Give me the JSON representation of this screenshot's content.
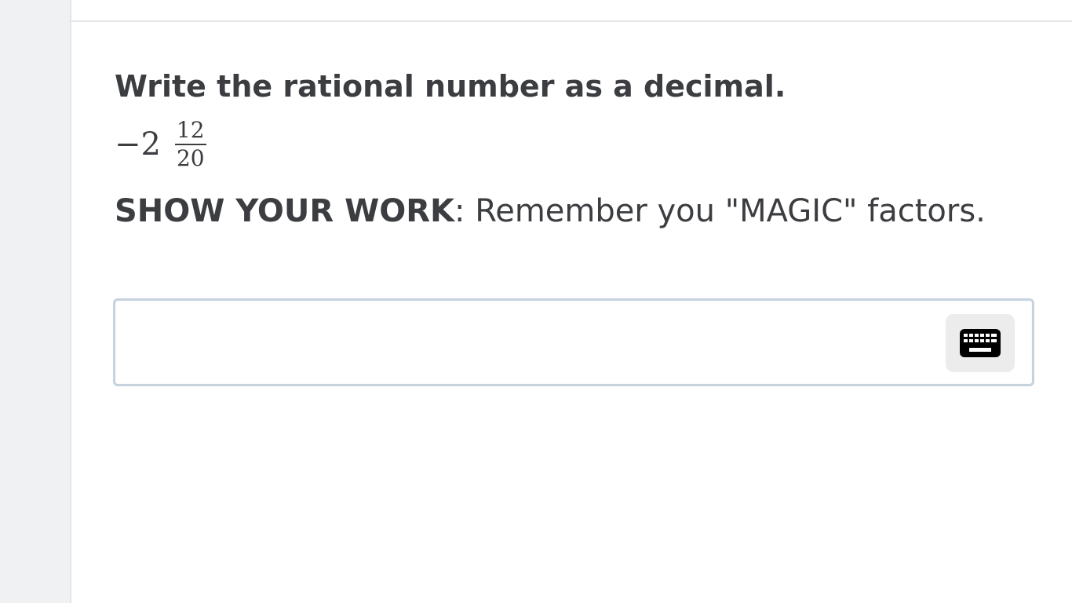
{
  "question": {
    "prompt": "Write the rational number as a decimal.",
    "expression": {
      "whole": "−2",
      "numerator": "12",
      "denominator": "20"
    },
    "instruction_strong": "SHOW YOUR WORK",
    "instruction_rest": ": Remember you \"MAGIC\" factors."
  },
  "answer": {
    "value": "",
    "keyboard_icon": "keyboard-icon"
  },
  "colors": {
    "text": "#3b3d40",
    "input_border": "#c6d3df",
    "keyboard_bg": "#ececec",
    "rail": "#f0f1f3"
  }
}
